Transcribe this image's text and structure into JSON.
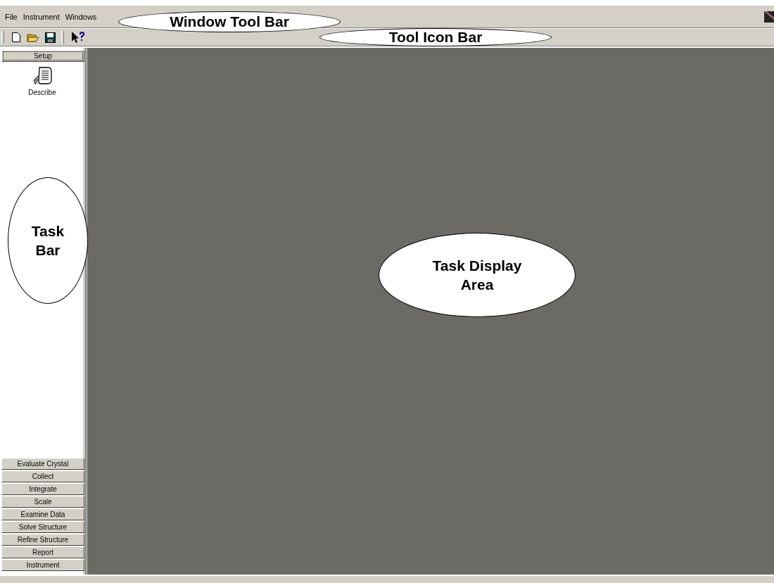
{
  "menu_bar": {
    "items": [
      "File",
      "Instrument",
      "Windows"
    ]
  },
  "toolbar": {
    "buttons": [
      {
        "kind": "new"
      },
      {
        "kind": "open"
      },
      {
        "kind": "save"
      },
      {
        "kind": "help"
      }
    ]
  },
  "task_bar": {
    "top_button": {
      "label": "Setup",
      "selected": true
    },
    "tasks": [
      {
        "label": "Describe",
        "kind": "describe"
      }
    ],
    "buttons": [
      {
        "label": "Evaluate Crystal",
        "selected": false
      },
      {
        "label": "Collect",
        "selected": false
      },
      {
        "label": "Integrate",
        "selected": false
      },
      {
        "label": "Scale",
        "selected": false
      },
      {
        "label": "Examine Data",
        "selected": false
      },
      {
        "label": "Solve Structure",
        "selected": false
      },
      {
        "label": "Refine Structure",
        "selected": false
      },
      {
        "label": "Report",
        "selected": false
      },
      {
        "label": "Instrument",
        "selected": false
      }
    ]
  },
  "callouts": [
    {
      "label": "Window Tool Bar",
      "kind": "window-toolbar"
    },
    {
      "label": "Tool Icon Bar",
      "kind": "tool-icon-bar"
    },
    {
      "label": "Task Bar",
      "kind": "task-bar"
    },
    {
      "label": "Task Display Area",
      "kind": "display-area"
    }
  ]
}
